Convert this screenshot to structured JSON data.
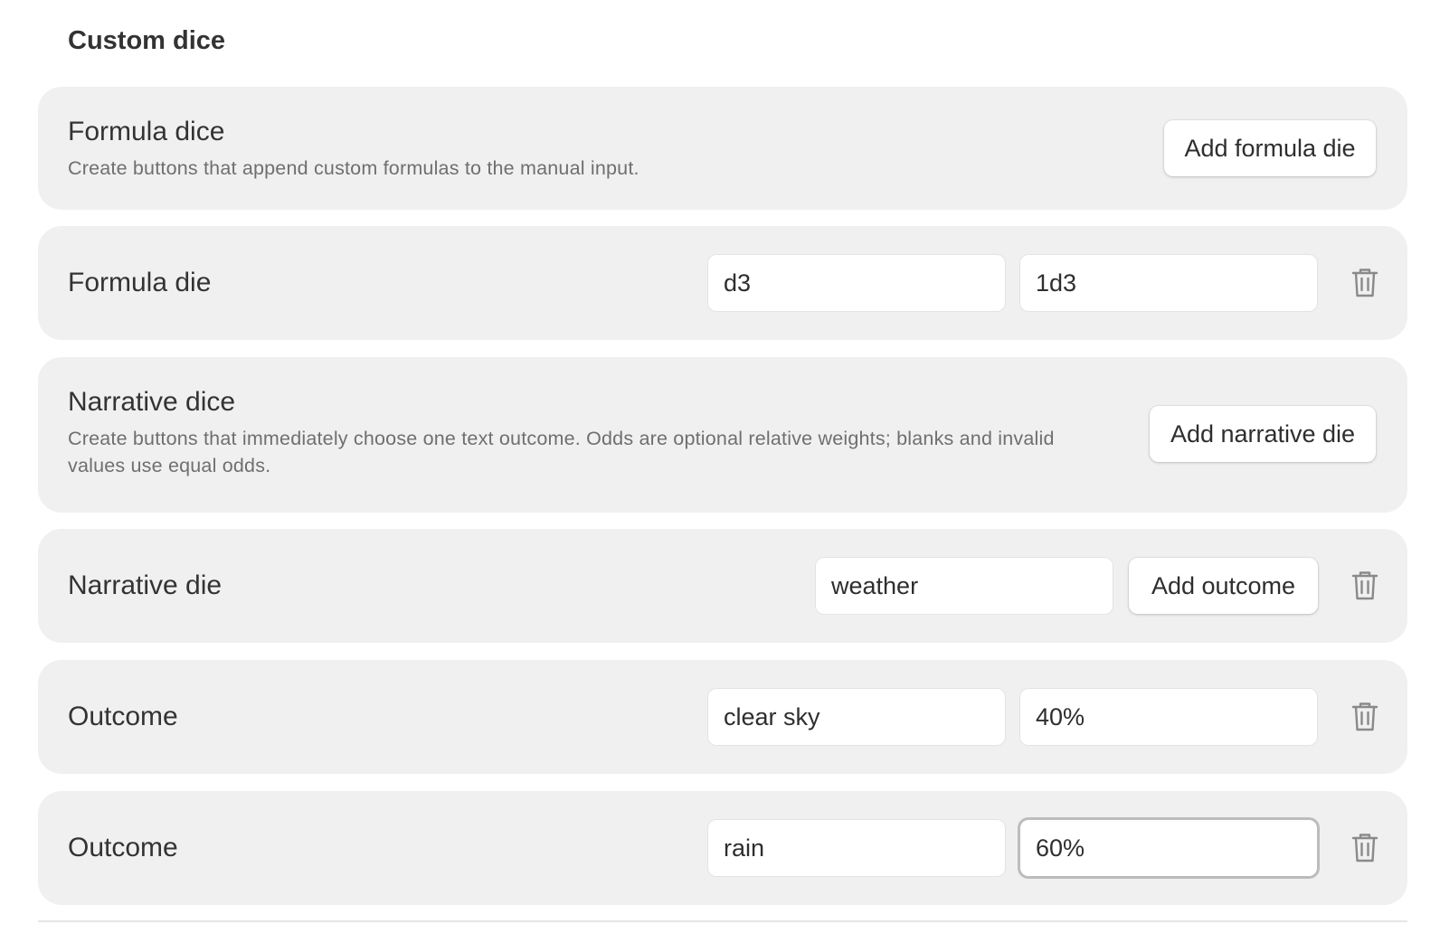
{
  "section_title": "Custom dice",
  "formula_section": {
    "title": "Formula dice",
    "description": "Create buttons that append custom formulas to the manual input.",
    "add_button": "Add formula die"
  },
  "formula_die": {
    "label": "Formula die",
    "name_value": "d3",
    "formula_value": "1d3",
    "delete_icon": "trash-icon"
  },
  "narrative_section": {
    "title": "Narrative dice",
    "description": "Create buttons that immediately choose one text outcome. Odds are optional relative weights; blanks and invalid values use equal odds.",
    "add_button": "Add narrative die"
  },
  "narrative_die": {
    "label": "Narrative die",
    "name_value": "weather",
    "add_outcome_button": "Add outcome",
    "delete_icon": "trash-icon"
  },
  "outcomes": [
    {
      "label": "Outcome",
      "text_value": "clear sky",
      "odds_value": "40%",
      "delete_icon": "trash-icon"
    },
    {
      "label": "Outcome",
      "text_value": "rain",
      "odds_value": "60%",
      "delete_icon": "trash-icon",
      "focused": true
    }
  ]
}
